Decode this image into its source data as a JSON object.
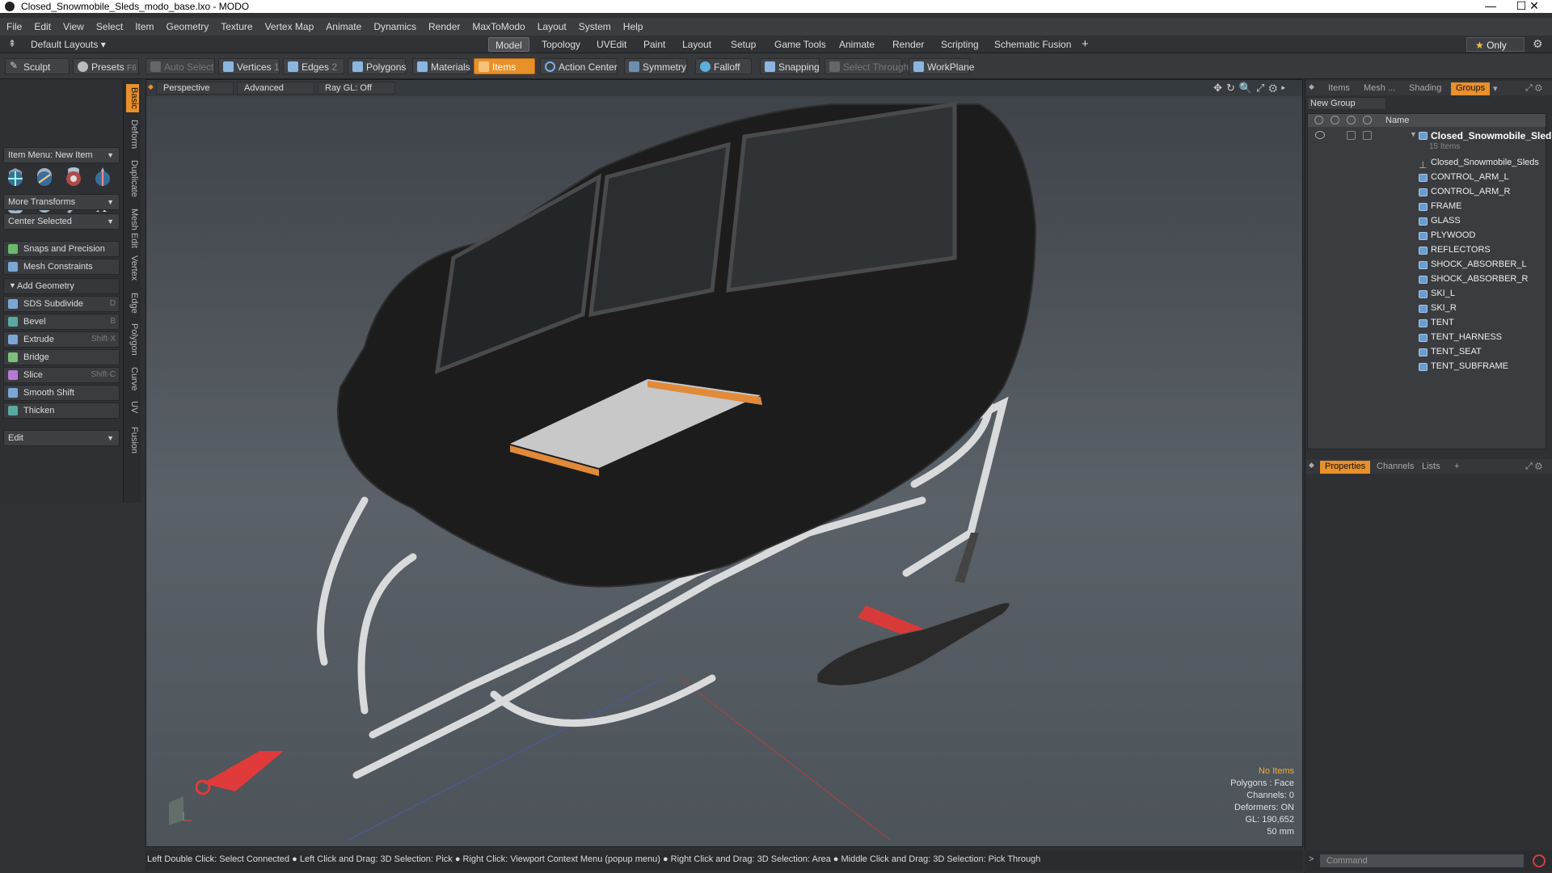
{
  "window": {
    "title": "Closed_Snowmobile_Sleds_modo_base.lxo - MODO",
    "controls": [
      "—",
      "☐",
      "✕"
    ]
  },
  "menu": [
    "File",
    "Edit",
    "View",
    "Select",
    "Item",
    "Geometry",
    "Texture",
    "Vertex Map",
    "Animate",
    "Dynamics",
    "Render",
    "MaxToModo",
    "Layout",
    "System",
    "Help"
  ],
  "layouts": {
    "preset": "Default Layouts",
    "tabs": [
      "Model",
      "Topology",
      "UVEdit",
      "Paint",
      "Layout",
      "Setup",
      "Game Tools",
      "Animate",
      "Render",
      "Scripting",
      "Schematic Fusion"
    ],
    "active_tab": "Model",
    "only_label": "Only"
  },
  "toolbar": {
    "sculpt": "Sculpt",
    "presets": "Presets",
    "presets_key": "F6",
    "auto_select": "Auto Select",
    "vertices": "Vertices",
    "vertices_count": "1",
    "edges": "Edges",
    "edges_count": "2",
    "polygons": "Polygons",
    "materials": "Materials",
    "items": "Items",
    "action_center": "Action Center",
    "symmetry": "Symmetry",
    "falloff": "Falloff",
    "snapping": "Snapping",
    "select_through": "Select Through",
    "workplane": "WorkPlane"
  },
  "left": {
    "item_menu": "Item Menu: New Item",
    "more_transforms": "More Transforms",
    "center_selected": "Center Selected",
    "snaps": "Snaps and Precision",
    "mesh_constraints": "Mesh Constraints",
    "add_geometry": "Add Geometry",
    "tools": [
      {
        "label": "SDS Subdivide",
        "key": "D"
      },
      {
        "label": "Bevel",
        "key": "B"
      },
      {
        "label": "Extrude",
        "key": "Shift-X"
      },
      {
        "label": "Bridge",
        "key": ""
      },
      {
        "label": "Slice",
        "key": "Shift-C"
      },
      {
        "label": "Smooth Shift",
        "key": ""
      },
      {
        "label": "Thicken",
        "key": ""
      }
    ],
    "edit": "Edit"
  },
  "side_tabs": [
    "Basic",
    "Deform",
    "Duplicate",
    "Mesh Edit",
    "Vertex",
    "Edge",
    "Polygon",
    "Curve",
    "UV",
    "Fusion"
  ],
  "viewport": {
    "view": "Perspective",
    "shading": "Advanced",
    "raygl": "Ray GL: Off",
    "stats": {
      "selection": "No Items",
      "polygons": "Polygons : Face",
      "channels": "Channels: 0",
      "deformers": "Deformers: ON",
      "gl": "GL: 190,652",
      "grid": "50 mm"
    }
  },
  "statusbar": "Left Double Click: Select Connected ● Left Click and Drag: 3D Selection: Pick ● Right Click: Viewport Context Menu (popup menu) ● Right Click and Drag: 3D Selection: Area ● Middle Click and Drag: 3D Selection: Pick Through",
  "right": {
    "top_tabs": [
      "Items",
      "Mesh ...",
      "Shading",
      "Groups"
    ],
    "active_top": "Groups",
    "new_group": "New Group",
    "col_name": "Name",
    "root": {
      "label": "Closed_Snowmobile_Sled ...",
      "count": "15 Items"
    },
    "items": [
      "Closed_Snowmobile_Sleds",
      "CONTROL_ARM_L",
      "CONTROL_ARM_R",
      "FRAME",
      "GLASS",
      "PLYWOOD",
      "REFLECTORS",
      "SHOCK_ABSORBER_L",
      "SHOCK_ABSORBER_R",
      "SKI_L",
      "SKI_R",
      "TENT",
      "TENT_HARNESS",
      "TENT_SEAT",
      "TENT_SUBFRAME"
    ],
    "bottom_tabs": [
      "Properties",
      "Channels",
      "Lists"
    ],
    "active_bottom": "Properties",
    "command_placeholder": "Command"
  },
  "colors": {
    "accent": "#e8902a",
    "viewport_bg": "#4a5056",
    "item_icon": "#6a9ccf"
  }
}
